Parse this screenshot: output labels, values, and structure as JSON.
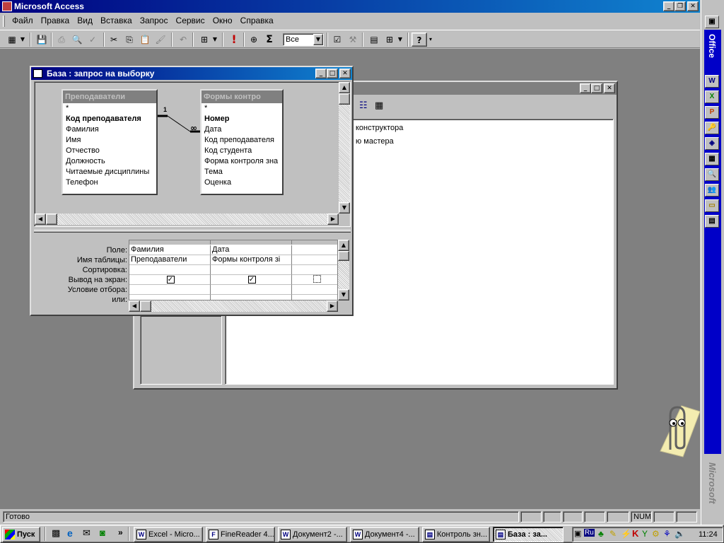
{
  "app": {
    "title": "Microsoft Access"
  },
  "menu": [
    "Файл",
    "Правка",
    "Вид",
    "Вставка",
    "Запрос",
    "Сервис",
    "Окно",
    "Справка"
  ],
  "toolbar": {
    "combo_value": "Все",
    "sigma": "Σ",
    "exclaim": "!",
    "help": "?"
  },
  "db_window": {
    "items": [
      "конструктора",
      "ю мастера"
    ]
  },
  "query_window": {
    "title": "База : запрос на выборку",
    "tables": [
      {
        "name": "Преподаватели",
        "fields": [
          "*",
          "Код преподавателя",
          "Фамилия",
          "Имя",
          "Отчество",
          "Должность",
          "Читаемые дисциплины",
          "Телефон"
        ]
      },
      {
        "name": "Формы контро",
        "fields": [
          "*",
          "Номер",
          "Дата",
          "Код преподавателя",
          "Код студента",
          "Форма контроля зна",
          "Тема",
          "Оценка"
        ]
      }
    ],
    "join": {
      "one": "1",
      "many": "∞"
    },
    "grid": {
      "row_labels": [
        "Поле:",
        "Имя таблицы:",
        "Сортировка:",
        "Вывод на экран:",
        "Условие отбора:",
        "или:"
      ],
      "columns": [
        {
          "field": "Фамилия",
          "table": "Преподаватели",
          "show": "✓"
        },
        {
          "field": "Дата",
          "table": "Формы контроля зі",
          "show": "✓"
        },
        {
          "field": "",
          "table": "",
          "show": ""
        }
      ]
    }
  },
  "status": {
    "text": "Готово",
    "num": "NUM"
  },
  "officebar": {
    "label": "Office",
    "brand": "Microsoft"
  },
  "taskbar": {
    "start": "Пуск",
    "quick_more": "»",
    "tasks": [
      "Excel - Micro...",
      "FineReader 4...",
      "Документ2 -...",
      "Документ4 -...",
      "Контроль зн...",
      "База : за..."
    ],
    "lang": "Ru",
    "clock": "11:24"
  }
}
